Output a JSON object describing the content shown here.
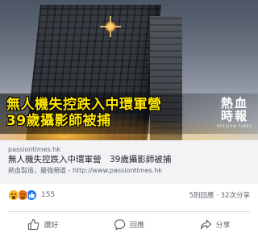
{
  "preview": {
    "headline_line1": "無人機失控跌入中環軍營",
    "headline_line2": "39歲攝影師被捕",
    "logo_cn": "熱血時報",
    "logo_en": "PASSION TIMES"
  },
  "link": {
    "domain": "passiontimes.hk",
    "title": "無人機失控跌入中環軍營　39歲攝影師被捕",
    "description": "熱血製造，最強頻道 - http://www.passiontimes.hk"
  },
  "reactions": {
    "icons": [
      "wow-reaction-icon",
      "angry-reaction-icon",
      "like-reaction-icon"
    ],
    "count": "155",
    "comments": "5則回應",
    "separator": "·",
    "shares": "32次分享"
  },
  "actions": {
    "like_label": "讚好",
    "comment_label": "回應",
    "share_label": "分享"
  },
  "colors": {
    "headline": "#ffe600",
    "like_blue": "#1877f2",
    "muted_text": "#606770",
    "meta_background": "#f2f3f5"
  }
}
